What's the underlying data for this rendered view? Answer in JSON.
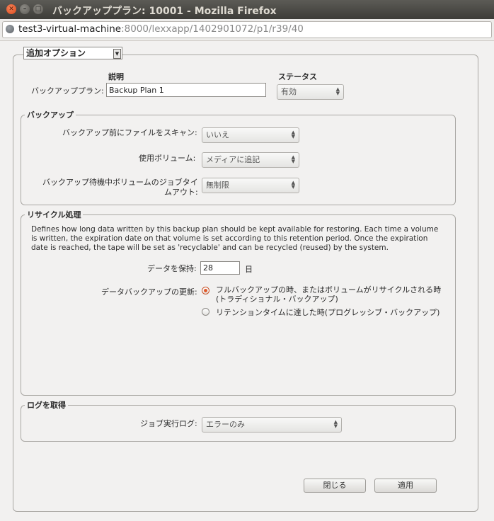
{
  "window": {
    "title": "バックアッププラン: 10001 - Mozilla Firefox",
    "close_glyph": "✕",
    "min_glyph": "–",
    "max_glyph": "□"
  },
  "urlbar": {
    "host": "test3-virtual-machine",
    "path": ":8000/lexxapp/1402901072/p1/r39/40"
  },
  "options_dropdown": {
    "value": "追加オプション"
  },
  "plan": {
    "description_header": "説明",
    "status_header": "ステータス",
    "plan_label": "バックアッププラン:",
    "plan_value": "Backup Plan 1",
    "status_value": "有効"
  },
  "backup": {
    "title": "バックアップ",
    "scan_label": "バックアップ前にファイルをスキャン:",
    "scan_value": "いいえ",
    "volume_label": "使用ボリューム:",
    "volume_value": "メディアに追記",
    "timeout_label_line1": "バックアップ待機中ボリュームのジョブタイ",
    "timeout_label_line2": "ムアウト:",
    "timeout_value": "無制限"
  },
  "recycle": {
    "title": "リサイクル処理",
    "description": "Defines how long data written by this backup plan should be kept available for restoring. Each time a volume is written, the expiration date on that volume is set according to this retention period. Once the expiration date is reached, the tape will be set as 'recyclable' and can be recycled (reused) by the system.",
    "retain_label": "データを保持:",
    "retain_value": "28",
    "retain_unit": "日",
    "update_label": "データバックアップの更新:",
    "option1_line1": "フルバックアップの時、またはボリュームがリサイクルされる時",
    "option1_line2": "(トラディショナル・バックアップ)",
    "option2": "リテンションタイムに達した時(プログレッシブ・バックアップ)",
    "selected_option": 1
  },
  "log": {
    "title": "ログを取得",
    "job_log_label": "ジョブ実行ログ:",
    "job_log_value": "エラーのみ"
  },
  "buttons": {
    "close": "閉じる",
    "apply": "適用"
  },
  "colors": {
    "titlebar": "#3d3c38",
    "close_button": "#dc4a1c",
    "radio_selected": "#e05a2b",
    "background": "#f2f1f0"
  }
}
